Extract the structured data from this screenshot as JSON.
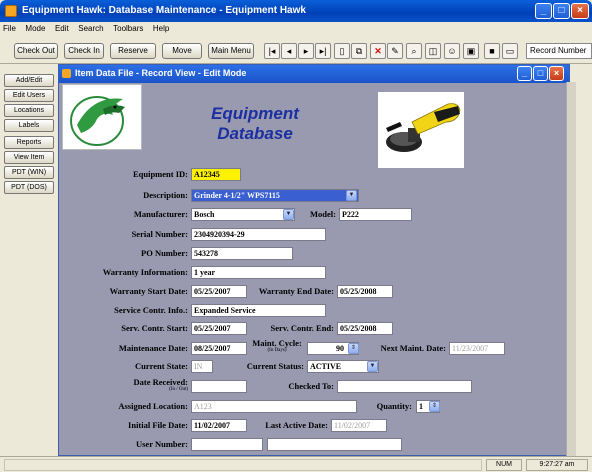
{
  "window": {
    "title": "Equipment Hawk:  Database Maintenance - Equipment Hawk"
  },
  "menu": [
    "File",
    "Mode",
    "Edit",
    "Search",
    "Toolbars",
    "Help"
  ],
  "toolbar": {
    "buttons": [
      "Check Out",
      "Check In",
      "Reserve",
      "Move",
      "Main Menu"
    ],
    "record_label": "Record Number"
  },
  "side": [
    "Add/Edit",
    "Edit Users",
    "Locations",
    "Labels",
    "Reports",
    "View Item",
    "PDT (WIN)",
    "PDT (DOS)"
  ],
  "inner": {
    "title": "Item Data File - Record View - Edit Mode"
  },
  "header": {
    "title_line1": "Equipment",
    "title_line2": "Database"
  },
  "form": {
    "equipment_id_label": "Equipment ID:",
    "equipment_id": "A12345",
    "description_label": "Description:",
    "description": "Grinder 4-1/2\" WPS7115",
    "manufacturer_label": "Manufacturer:",
    "manufacturer": "Bosch",
    "model_label": "Model:",
    "model": "P222",
    "serial_label": "Serial Number:",
    "serial": "2304920394-29",
    "po_label": "PO Number:",
    "po": "543278",
    "warranty_info_label": "Warranty Information:",
    "warranty_info": "1 year",
    "warranty_start_label": "Warranty Start Date:",
    "warranty_start": "05/25/2007",
    "warranty_end_label": "Warranty End Date:",
    "warranty_end": "05/25/2008",
    "service_info_label": "Service Contr. Info.:",
    "service_info": "Expanded Service",
    "serv_start_label": "Serv. Contr. Start:",
    "serv_start": "05/25/2007",
    "serv_end_label": "Serv. Contr. End:",
    "serv_end": "05/25/2008",
    "maint_date_label": "Maintenance Date:",
    "maint_date": "08/25/2007",
    "maint_cycle_label": "Maint. Cycle:",
    "maint_cycle_unit": "(In Days)",
    "maint_cycle": "90",
    "next_maint_label": "Next Maint. Date:",
    "next_maint": "11/23/2007",
    "current_state_label": "Current State:",
    "current_state": "IN",
    "current_status_label": "Current Status:",
    "current_status": "ACTIVE",
    "date_received_label": "Date Received:",
    "date_received_unit": "(In / Out)",
    "date_received": "",
    "checked_to_label": "Checked To:",
    "checked_to": "",
    "assigned_location_label": "Assigned Location:",
    "assigned_location": "A123",
    "quantity_label": "Quantity:",
    "quantity": "1",
    "initial_file_label": "Initial File Date:",
    "initial_file": "11/02/2007",
    "last_active_label": "Last Active Date:",
    "last_active": "11/02/2007",
    "user_number_label": "User Number:",
    "user_number": ""
  },
  "status": {
    "num": "NUM",
    "time": "9:27:27 am"
  },
  "colors": {
    "title_blue": "#0a52c8",
    "form_bg": "#9999b0",
    "heading": "#1c2fa0",
    "highlight": "#fff200"
  }
}
